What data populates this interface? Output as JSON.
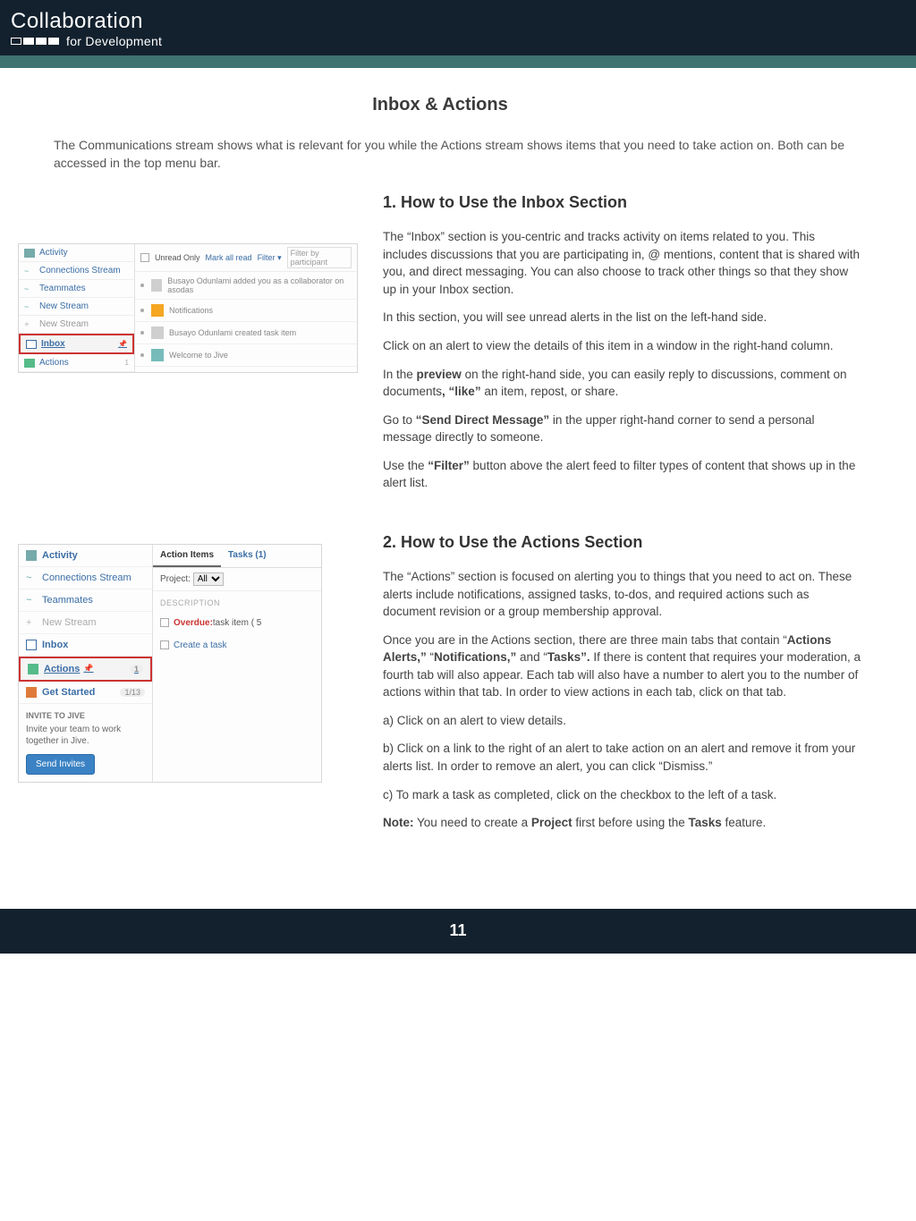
{
  "brand": {
    "top": "Collaboration",
    "bottom": "for Development"
  },
  "page_title": "Inbox & Actions",
  "intro": "The Communications stream shows what is relevant for you while the Actions stream shows items that you need to take action on. Both can be accessed in the top menu bar.",
  "section1": {
    "head": "1.  How to Use the Inbox Section",
    "p1a": "The “Inbox” section is you-centric and tracks activity on items related to you. This includes discussions that you are participating in, @ mentions, content that is shared with you, and direct messaging. You can also choose to track other things so that they show up in your Inbox section.",
    "p2": "In this section, you will see unread alerts in the list on the left-hand side.",
    "p3": "Click on an alert to view the details of this item in a window in the right-hand column.",
    "p4a": "In the ",
    "p4b": "preview",
    "p4c": " on the right-hand side, you can easily reply to discussions, comment on documents",
    "p4d": ", “like”",
    "p4e": " an item, repost, or share.",
    "p5a": "Go to  ",
    "p5b": "“Send Direct Message”",
    "p5c": "  in the upper right-hand corner to send a personal message directly to someone.",
    "p6a": "Use the ",
    "p6b": "“Filter”",
    "p6c": " button above the alert feed to filter types of content that shows up in the alert list."
  },
  "section2": {
    "head": "2.   How to Use the Actions Section",
    "p1": "The “Actions”  section is focused on alerting you to things that you need to act on. These alerts include notifications, assigned  tasks, to-dos,  and required actions such as document revision or a group membership approval.",
    "p2a": "Once you are in the Actions section, there are three main tabs that contain “",
    "p2b": "Actions Alerts,”",
    "p2c": " “",
    "p2d": "Notifications,”",
    "p2e": " and “",
    "p2f": "Tasks”.",
    "p2g": " If there is content that requires your moderation, a fourth tab will also appear. Each tab will also have a number to alert you to the number of actions within that tab. In order to view actions in each tab, click on that tab.",
    "p3": "a) Click on an alert to view details.",
    "p4": "b) Click on a link to the right of an alert to take action on an alert and remove it from your alerts list.  In order to remove an alert, you can click “Dismiss.”",
    "p5": "c) To mark a task as completed, click on the checkbox to the left of a task.",
    "p6a": "Note:",
    "p6b": " You need to create a ",
    "p6c": "Project",
    "p6d": " first before using the ",
    "p6e": "Tasks",
    "p6f": " feature."
  },
  "shot1": {
    "nav": {
      "activity": "Activity",
      "connections": "Connections Stream",
      "teammates": "Teammates",
      "newstream": "New Stream",
      "newstream2": "New Stream",
      "inbox": "Inbox",
      "actions": "Actions"
    },
    "top": {
      "unread": "Unread Only",
      "markall": "Mark all read",
      "filter": "Filter ▾",
      "placeholder": "Filter by participant"
    },
    "items": [
      "Busayo Odunlami added you as a collaborator on    asodas",
      "Notifications",
      "Busayo Odunlami created    task item",
      "Welcome to Jive"
    ]
  },
  "shot2": {
    "nav": {
      "activity": "Activity",
      "connections": "Connections Stream",
      "teammates": "Teammates",
      "newstream": "New Stream",
      "inbox": "Inbox",
      "actions": "Actions",
      "badge": "1",
      "getstarted": "Get Started",
      "gsbadge": "1/13"
    },
    "invite": {
      "head": "INVITE TO JIVE",
      "text": "Invite your team to work together in Jive.",
      "btn": "Send Invites"
    },
    "tabs": {
      "action": "Action Items",
      "tasks": "Tasks (1)"
    },
    "project": {
      "label": "Project:",
      "value": "All"
    },
    "desc": "DESCRIPTION",
    "task": {
      "overdue": "Overdue:",
      "item": " task item ( 5"
    },
    "create": "Create a task"
  },
  "page_num": "11"
}
